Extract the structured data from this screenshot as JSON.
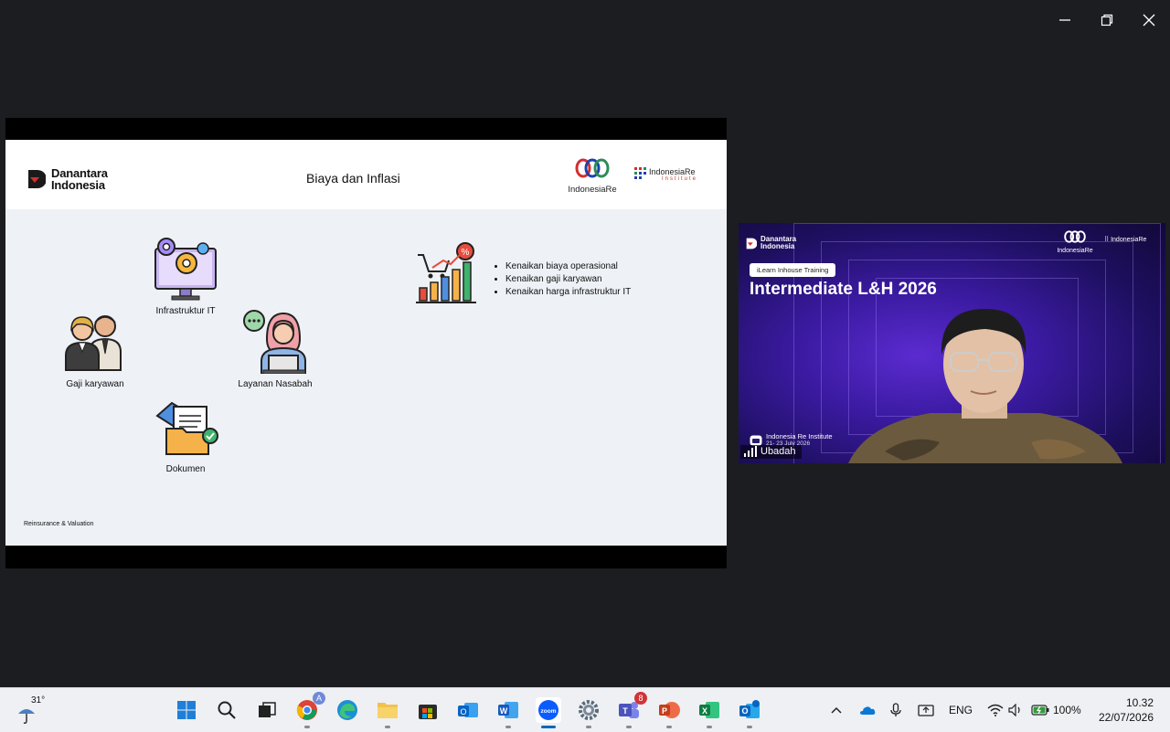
{
  "window": {
    "controls": [
      "minimize",
      "restore",
      "close"
    ]
  },
  "slide": {
    "brand_left": [
      "Danantara",
      "Indonesia"
    ],
    "title": "Biaya dan Inflasi",
    "brand_indonesia_re": "IndonesiaRe",
    "brand_institute": {
      "name": "IndonesiaRe",
      "sub": "Institute"
    },
    "items": {
      "infra": "Infrastruktur IT",
      "gaji": "Gaji karyawan",
      "layanan": "Layanan Nasabah",
      "dokumen": "Dokumen"
    },
    "bullets": [
      "Kenaikan biaya operasional",
      "Kenaikan gaji karyawan",
      "Kenaikan harga infrastruktur IT"
    ],
    "footer": "Reinsurance & Valuation"
  },
  "video": {
    "brand_left": [
      "Danantara",
      "Indonesia"
    ],
    "brand_indonesia_re": "IndonesiaRe",
    "brand_institute": "IndonesiaRe",
    "pill": "iLearn Inhouse Training",
    "title": "Intermediate L&H 2026",
    "institute_line1": "Indonesia Re Institute",
    "institute_line2": "21- 23 July  2026",
    "participant_name": "Ubadah"
  },
  "taskbar": {
    "weather_temp": "31°",
    "apps": [
      "start",
      "search",
      "task-view",
      "chrome",
      "edge",
      "file-explorer",
      "microsoft-store",
      "outlook-new",
      "word",
      "zoom",
      "settings",
      "teams",
      "powerpoint",
      "excel",
      "outlook"
    ],
    "active_app": "zoom",
    "teams_badge": "8",
    "language": "ENG",
    "battery": "100%",
    "time": "10.32",
    "date": "22/07/2026"
  },
  "colors": {
    "zoom_blue": "#0b5cff",
    "accent": "#0067c0",
    "slide_bg": "#eef1f6",
    "video_purple": "#3a1aa0"
  }
}
